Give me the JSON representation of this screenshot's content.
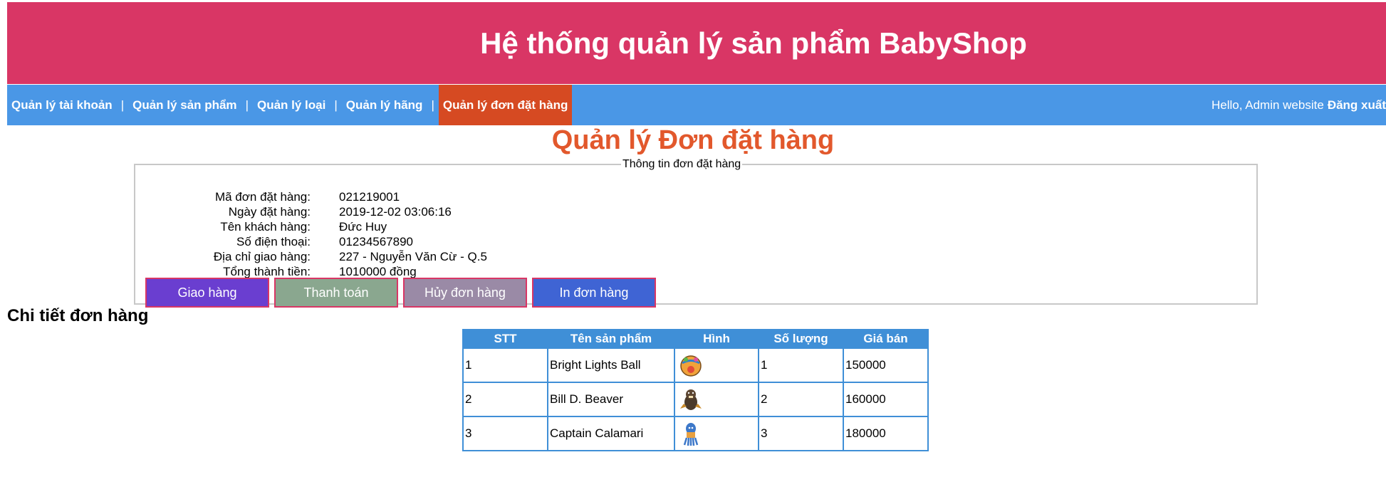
{
  "header": {
    "title": "Hệ thống quản lý sản phẩm BabyShop"
  },
  "nav": {
    "items": [
      {
        "label": "Quản lý tài khoản"
      },
      {
        "label": "Quản lý sản phẩm"
      },
      {
        "label": "Quản lý loại"
      },
      {
        "label": "Quản lý hãng"
      },
      {
        "label": "Quản lý đơn đặt hàng"
      }
    ],
    "separator": "|",
    "hello": "Hello, Admin website",
    "logout": "Đăng xuất"
  },
  "page": {
    "title": "Quản lý Đơn đặt hàng"
  },
  "order_info": {
    "legend": "Thông tin đơn đặt hàng",
    "rows": [
      {
        "label": "Mã đơn đặt hàng:",
        "value": "021219001"
      },
      {
        "label": "Ngày đặt hàng:",
        "value": "2019-12-02 03:06:16"
      },
      {
        "label": "Tên khách hàng:",
        "value": "Đức Huy"
      },
      {
        "label": "Số điện thoại:",
        "value": "01234567890"
      },
      {
        "label": "Địa chỉ giao hàng:",
        "value": "227 - Nguyễn Văn Cừ - Q.5"
      },
      {
        "label": "Tổng thành tiền:",
        "value": "1010000 đồng"
      }
    ],
    "buttons": {
      "ship": "Giao hàng",
      "pay": "Thanh toán",
      "cancel": "Hủy đơn hàng",
      "print": "In đơn hàng"
    }
  },
  "details": {
    "heading": "Chi tiết đơn hàng",
    "columns": [
      "STT",
      "Tên sản phẩm",
      "Hình",
      "Số lượng",
      "Giá bán"
    ],
    "rows": [
      {
        "stt": "1",
        "name": "Bright Lights Ball",
        "image": "ball-toy-thumbnail",
        "qty": "1",
        "price": "150000"
      },
      {
        "stt": "2",
        "name": "Bill D. Beaver",
        "image": "beaver-toy-thumbnail",
        "qty": "2",
        "price": "160000"
      },
      {
        "stt": "3",
        "name": "Captain Calamari",
        "image": "squid-toy-thumbnail",
        "qty": "3",
        "price": "180000"
      }
    ]
  },
  "colors": {
    "header_bg": "#d93665",
    "nav_bg": "#4a97e6",
    "nav_active_bg": "#d64a22",
    "title_color": "#e2582c",
    "table_border": "#3f8fd7"
  }
}
